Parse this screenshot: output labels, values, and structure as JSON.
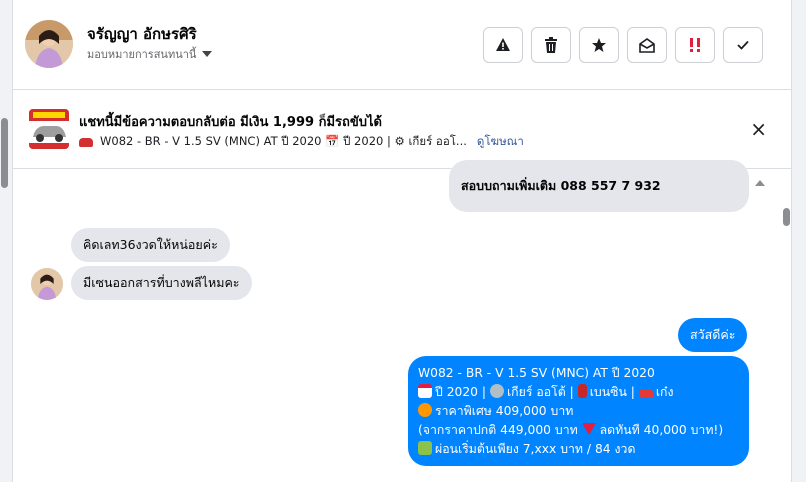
{
  "header": {
    "contact_name": "จรัญญา อักษรศิริ",
    "assign_label": "มอบหมายการสนทนานี้",
    "actions": [
      "spam-icon",
      "trash-icon",
      "star-icon",
      "mark-unread-icon",
      "important-icon",
      "done-icon"
    ]
  },
  "ad": {
    "title": "แชทนี้มีข้อความตอบกลับต่อ มีเงิน 1,999 ก็มีรถขับได้",
    "subtitle": "W082 - BR - V 1.5 SV (MNC) AT ปี 2020 📅 ปี 2020 | ⚙ เกียร์ ออโ...",
    "link": "ดูโฆษณา",
    "close": "×"
  },
  "messages": {
    "out_top": "สอบบถามเพิ่มเติม  088 557 7 932",
    "in_1": "คิดเลท36งวดให้หน่อยค่ะ",
    "in_2": "มีเซนออกสารที่บางพลีไหมคะ",
    "out_greeting": "สวัสดีค่ะ",
    "out_car": {
      "line1": "W082 - BR - V 1.5 SV (MNC) AT ปี 2020",
      "line2": "ปี 2020 | ",
      "line2b": "เกียร์ ออโต้ | ",
      "line2c": "เบนซิน | ",
      "line2d": "เก๋ง",
      "line3": "ราคาพิเศษ 409,000 บาท",
      "line4a": "(จากราคาปกติ 449,000 บาท ",
      "line4b": "ลดทันที 40,000 บาท!)",
      "line5": "ผ่อนเริ่มต้นเพียง 7,xxx บาท / 84 งวด"
    }
  },
  "colors": {
    "accent": "#0084ff",
    "incoming_bubble": "#e4e6eb",
    "important_red": "#e41e3f"
  }
}
